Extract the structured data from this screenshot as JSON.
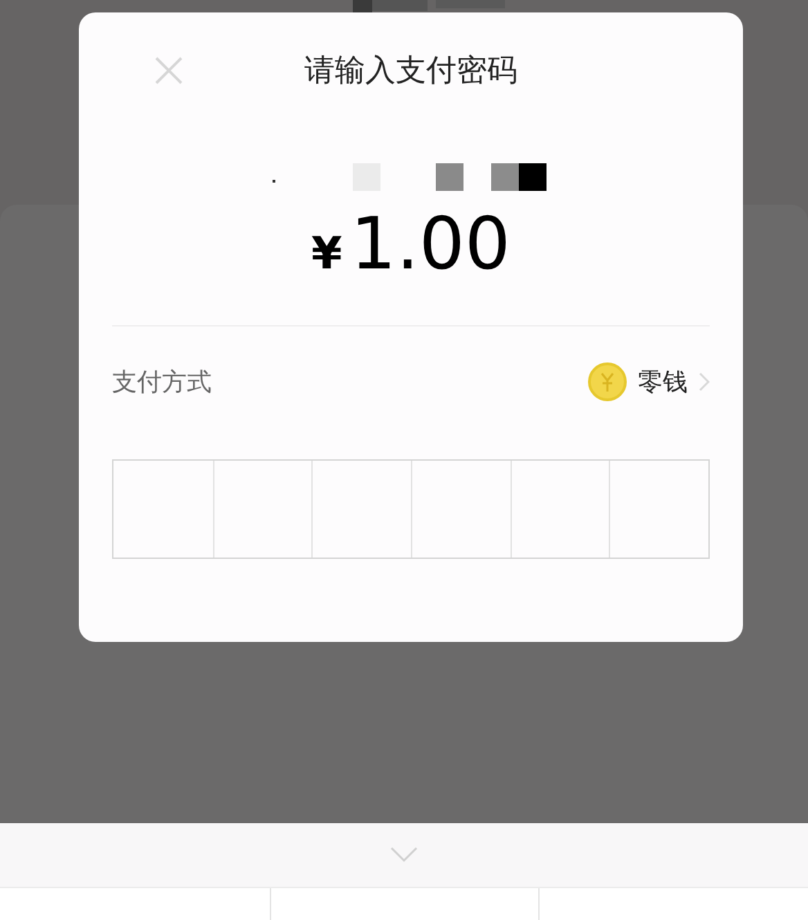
{
  "dialog": {
    "title": "请输入支付密码",
    "amount": {
      "currency": "¥",
      "value": "1.00"
    },
    "payment_method": {
      "label": "支付方式",
      "value": "零钱"
    },
    "password_cells": [
      {
        "filled": false
      },
      {
        "filled": false
      },
      {
        "filled": false
      },
      {
        "filled": false
      },
      {
        "filled": false
      },
      {
        "filled": false
      }
    ]
  }
}
